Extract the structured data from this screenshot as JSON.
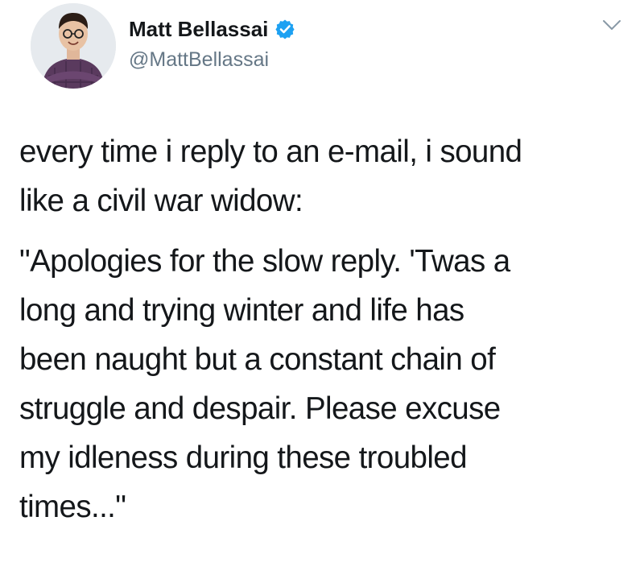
{
  "tweet": {
    "display_name": "Matt Bellassai",
    "handle": "@MattBellassai",
    "verified_icon": "verified-badge-icon",
    "menu_icon": "chevron-down-icon",
    "avatar_icon": "user-avatar",
    "paragraphs": [
      {
        "lines": [
          "every time i reply to an e-mail, i sound",
          "like a civil war widow:"
        ]
      },
      {
        "lines": [
          "\"Apologies for the slow reply. 'Twas a",
          "long and trying winter and life has",
          "been naught but a constant chain of",
          "struggle and despair. Please excuse",
          "my idleness during these troubled",
          "times...\""
        ]
      }
    ]
  },
  "colors": {
    "text": "#14171a",
    "handle": "#657786",
    "verified": "#1da1f2",
    "background": "#ffffff"
  }
}
